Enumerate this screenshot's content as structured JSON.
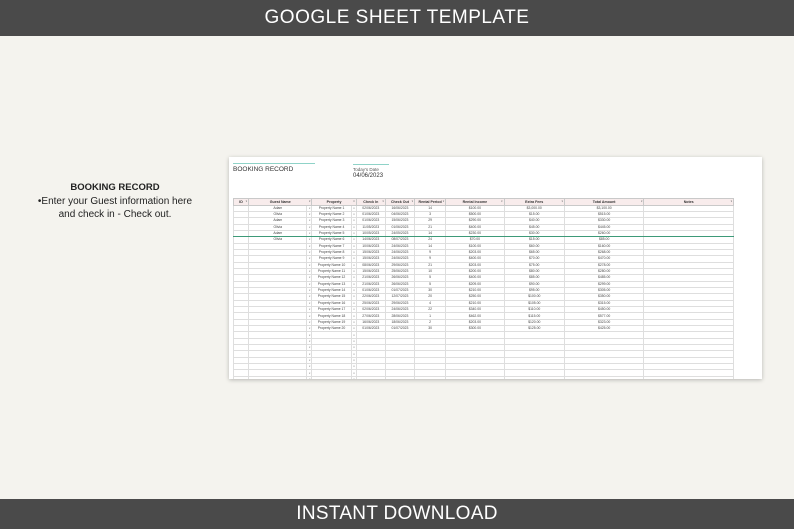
{
  "banner": {
    "top": "GOOGLE SHEET TEMPLATE",
    "bottom": "INSTANT DOWNLOAD"
  },
  "description": {
    "heading": "BOOKING RECORD",
    "line1": "•Enter your Guest information here",
    "line2": "and check in - Check out."
  },
  "sheet": {
    "title": "BOOKING RECORD",
    "todays_date_label": "Today's Date",
    "todays_date_value": "04/06/2023",
    "columns": [
      "ID",
      "Guest Name",
      "Property",
      "Check In",
      "Check Out",
      "Rental Period",
      "Rental Income",
      "Extra Fees",
      "Total Amount",
      "Notes"
    ],
    "rows": [
      [
        "",
        "Adam",
        "Property Name 1",
        "02/06/2023",
        "16/06/2023",
        "14",
        "$100.00",
        "$3,000.00",
        "$3,100.00",
        ""
      ],
      [
        "",
        "Olivia",
        "Property Name 2",
        "01/06/2023",
        "04/06/2023",
        "3",
        "$500.00",
        "$15.00",
        "$515.00",
        ""
      ],
      [
        "",
        "Adam",
        "Property Name 3",
        "01/06/2023",
        "15/06/2023",
        "29",
        "$290.00",
        "$40.00",
        "$330.00",
        ""
      ],
      [
        "",
        "Olivia",
        "Property Name 4",
        "11/05/2023",
        "01/06/2023",
        "21",
        "$400.00",
        "$45.00",
        "$445.00",
        ""
      ],
      [
        "",
        "Adam",
        "Property Name 5",
        "10/05/2023",
        "24/05/2023",
        "14",
        "$230.00",
        "$30.00",
        "$260.00",
        ""
      ],
      [
        "",
        "Olivia",
        "Property Name 6",
        "14/06/2023",
        "08/07/2023",
        "24",
        "$70.00",
        "$15.00",
        "$85.00",
        ""
      ],
      [
        "",
        "",
        "Property Name 7",
        "10/06/2023",
        "24/06/2023",
        "14",
        "$100.00",
        "$60.00",
        "$160.00",
        ""
      ],
      [
        "",
        "",
        "Property Name 8",
        "15/06/2023",
        "24/06/2023",
        "9",
        "$203.00",
        "$65.00",
        "$268.00",
        ""
      ],
      [
        "",
        "",
        "Property Name 9",
        "15/06/2023",
        "24/06/2023",
        "9",
        "$400.00",
        "$70.00",
        "$470.00",
        ""
      ],
      [
        "",
        "",
        "Property Name 10",
        "08/06/2023",
        "29/06/2023",
        "21",
        "$203.00",
        "$75.00",
        "$278.00",
        ""
      ],
      [
        "",
        "",
        "Property Name 11",
        "15/06/2023",
        "25/06/2023",
        "10",
        "$200.00",
        "$80.00",
        "$280.00",
        ""
      ],
      [
        "",
        "",
        "Property Name 12",
        "21/06/2023",
        "26/06/2023",
        "5",
        "$400.00",
        "$85.00",
        "$485.00",
        ""
      ],
      [
        "",
        "",
        "Property Name 13",
        "21/06/2023",
        "26/06/2023",
        "5",
        "$209.00",
        "$90.00",
        "$299.00",
        ""
      ],
      [
        "",
        "",
        "Property Name 14",
        "01/06/2023",
        "01/07/2023",
        "30",
        "$210.00",
        "$95.00",
        "$305.00",
        ""
      ],
      [
        "",
        "",
        "Property Name 15",
        "22/06/2023",
        "12/07/2023",
        "20",
        "$250.00",
        "$100.00",
        "$350.00",
        ""
      ],
      [
        "",
        "",
        "Property Name 16",
        "25/06/2023",
        "29/06/2023",
        "4",
        "$210.00",
        "$105.00",
        "$315.00",
        ""
      ],
      [
        "",
        "",
        "Property Name 17",
        "02/06/2023",
        "24/06/2023",
        "22",
        "$340.00",
        "$110.00",
        "$450.00",
        ""
      ],
      [
        "",
        "",
        "Property Name 18",
        "27/06/2023",
        "28/06/2023",
        "1",
        "$462.00",
        "$115.00",
        "$577.00",
        ""
      ],
      [
        "",
        "",
        "Property Name 19",
        "16/06/2023",
        "18/06/2023",
        "2",
        "$203.00",
        "$120.00",
        "$323.00",
        ""
      ],
      [
        "",
        "",
        "Property Name 20",
        "01/06/2023",
        "01/07/2023",
        "30",
        "$300.00",
        "$125.00",
        "$425.00",
        ""
      ]
    ]
  }
}
